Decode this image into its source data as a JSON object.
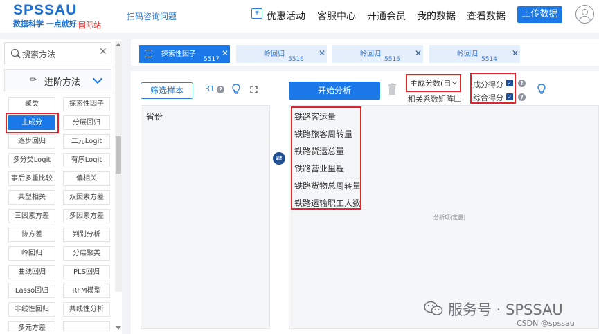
{
  "header": {
    "logo": "SPSSAU",
    "slogan": "数据科学 一点就好",
    "intl": "国际站",
    "scan_link": "扫码咨询问题",
    "nav": [
      "优惠活动",
      "客服中心",
      "开通会员",
      "我的数据",
      "查看数据"
    ],
    "upload": "上传数据"
  },
  "sidebar": {
    "search_placeholder": "搜索方法",
    "section_label": "进阶方法",
    "methods": [
      "聚类",
      "探索性因子",
      "主成分",
      "分层回归",
      "逐步回归",
      "二元Logit",
      "多分类Logit",
      "有序Logit",
      "事后多重比较",
      "偏相关",
      "典型相关",
      "双因素方差",
      "三因素方差",
      "多因素方差",
      "协方差",
      "判别分析",
      "岭回归",
      "分层聚类",
      "曲线回归",
      "PLS回归",
      "Lasso回归",
      "RFM模型",
      "非线性回归",
      "共线性分析",
      "多元方差",
      ""
    ],
    "active_method": "主成分"
  },
  "tabs": [
    {
      "label": "探索性因子",
      "num": "5517"
    },
    {
      "label": "岭回归",
      "num": "5516"
    },
    {
      "label": "岭回归",
      "num": "5515"
    },
    {
      "label": "岭回归",
      "num": "5514"
    }
  ],
  "workspace": {
    "filter_btn": "筛选样本",
    "count": "31",
    "variables": [
      "省份"
    ],
    "start_btn": "开始分析",
    "select_value": "主成分数(自",
    "corr_label": "相关系数矩阵",
    "option1": "成分得分",
    "option2": "综合得分",
    "analysis_items": [
      "铁路客运量",
      "铁路旅客周转量",
      "铁路货运总量",
      "铁路营业里程",
      "铁路货物总周转量",
      "铁路运输职工人数"
    ],
    "analysis_placeholder": "分析项(定量)"
  },
  "watermark": {
    "line1": "服务号 · SPSSAU",
    "line2": "CSDN @spssau"
  }
}
